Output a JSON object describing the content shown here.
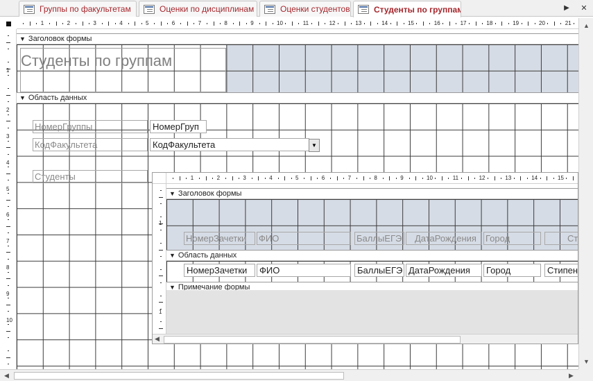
{
  "tabs": [
    {
      "label": "Группы по факультетам",
      "active": false
    },
    {
      "label": "Оценки по дисциплинам",
      "active": false
    },
    {
      "label": "Оценки студентов",
      "active": false
    },
    {
      "label": "Студенты по группам",
      "active": true
    }
  ],
  "icons": {
    "tab_icon": "form-icon",
    "collapse_icon": "section-collapse-icon",
    "dropdown_icon": "chevron-down-icon"
  },
  "ruler": {
    "horizontal_numbers": [
      "1",
      "2",
      "3",
      "4",
      "5",
      "6",
      "7",
      "8",
      "9",
      "10",
      "11",
      "12",
      "13",
      "14",
      "15",
      "16",
      "17",
      "18",
      "19",
      "20",
      "21"
    ],
    "vertical_numbers": [
      "1",
      "2",
      "3",
      "4",
      "5",
      "6",
      "7",
      "8",
      "9",
      "10"
    ],
    "sub_horizontal_numbers": [
      "1",
      "2",
      "3",
      "4",
      "5",
      "6",
      "7",
      "8",
      "9",
      "10",
      "11",
      "12",
      "13",
      "14",
      "15"
    ],
    "sub_vertical_numbers": [
      "1",
      "1"
    ]
  },
  "form": {
    "header_section": "Заголовок формы",
    "title": "Студенты по группам",
    "detail_section": "Область данных",
    "labels": {
      "group_number": "НомерГруппы",
      "faculty_code": "КодФакультета",
      "students": "Студенты"
    },
    "fields": {
      "group_number": "НомерГруп",
      "faculty_code": "КодФакультета"
    }
  },
  "subform": {
    "header_section": "Заголовок формы",
    "detail_section": "Область данных",
    "footer_section": "Примечание формы",
    "header_labels": [
      "НомерЗачетки",
      "ФИО",
      "БаллыЕГЭ",
      "ДатаРождения",
      "Город",
      "Сти"
    ],
    "detail_fields": [
      "НомерЗачетки",
      "ФИО",
      "БаллыЕГЭ",
      "ДатаРождения",
      "Город",
      "Стипенд"
    ]
  },
  "colors": {
    "tab_text": "#a4262c",
    "header_fill": "#d6dce5",
    "grid_line": "#3b3b3b"
  }
}
